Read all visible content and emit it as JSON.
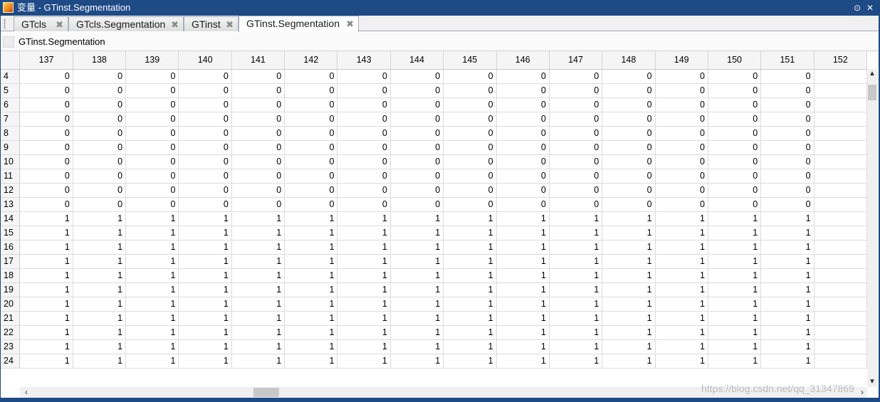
{
  "window": {
    "title": "变量 - GTinst.Segmentation",
    "menu_icon": "dropdown-circle-icon",
    "close_icon": "close-icon",
    "colors": {
      "titlebar": "#1e4a86",
      "background": "#ffffff",
      "header": "#f5f5f5"
    }
  },
  "tabs": [
    {
      "label": "GTcls",
      "active": false
    },
    {
      "label": "GTcls.Segmentation",
      "active": false
    },
    {
      "label": "GTinst",
      "active": false
    },
    {
      "label": "GTinst.Segmentation",
      "active": true
    }
  ],
  "variable": {
    "name": "GTinst.Segmentation"
  },
  "grid": {
    "columns": [
      "137",
      "138",
      "139",
      "140",
      "141",
      "142",
      "143",
      "144",
      "145",
      "146",
      "147",
      "148",
      "149",
      "150",
      "151",
      "152"
    ],
    "rows": [
      {
        "label": "4",
        "cells": [
          "0",
          "0",
          "0",
          "0",
          "0",
          "0",
          "0",
          "0",
          "0",
          "0",
          "0",
          "0",
          "0",
          "0",
          "0",
          ""
        ]
      },
      {
        "label": "5",
        "cells": [
          "0",
          "0",
          "0",
          "0",
          "0",
          "0",
          "0",
          "0",
          "0",
          "0",
          "0",
          "0",
          "0",
          "0",
          "0",
          ""
        ]
      },
      {
        "label": "6",
        "cells": [
          "0",
          "0",
          "0",
          "0",
          "0",
          "0",
          "0",
          "0",
          "0",
          "0",
          "0",
          "0",
          "0",
          "0",
          "0",
          ""
        ]
      },
      {
        "label": "7",
        "cells": [
          "0",
          "0",
          "0",
          "0",
          "0",
          "0",
          "0",
          "0",
          "0",
          "0",
          "0",
          "0",
          "0",
          "0",
          "0",
          ""
        ]
      },
      {
        "label": "8",
        "cells": [
          "0",
          "0",
          "0",
          "0",
          "0",
          "0",
          "0",
          "0",
          "0",
          "0",
          "0",
          "0",
          "0",
          "0",
          "0",
          ""
        ]
      },
      {
        "label": "9",
        "cells": [
          "0",
          "0",
          "0",
          "0",
          "0",
          "0",
          "0",
          "0",
          "0",
          "0",
          "0",
          "0",
          "0",
          "0",
          "0",
          ""
        ]
      },
      {
        "label": "10",
        "cells": [
          "0",
          "0",
          "0",
          "0",
          "0",
          "0",
          "0",
          "0",
          "0",
          "0",
          "0",
          "0",
          "0",
          "0",
          "0",
          ""
        ]
      },
      {
        "label": "11",
        "cells": [
          "0",
          "0",
          "0",
          "0",
          "0",
          "0",
          "0",
          "0",
          "0",
          "0",
          "0",
          "0",
          "0",
          "0",
          "0",
          ""
        ]
      },
      {
        "label": "12",
        "cells": [
          "0",
          "0",
          "0",
          "0",
          "0",
          "0",
          "0",
          "0",
          "0",
          "0",
          "0",
          "0",
          "0",
          "0",
          "0",
          ""
        ]
      },
      {
        "label": "13",
        "cells": [
          "0",
          "0",
          "0",
          "0",
          "0",
          "0",
          "0",
          "0",
          "0",
          "0",
          "0",
          "0",
          "0",
          "0",
          "0",
          ""
        ]
      },
      {
        "label": "14",
        "cells": [
          "1",
          "1",
          "1",
          "1",
          "1",
          "1",
          "1",
          "1",
          "1",
          "1",
          "1",
          "1",
          "1",
          "1",
          "1",
          ""
        ]
      },
      {
        "label": "15",
        "cells": [
          "1",
          "1",
          "1",
          "1",
          "1",
          "1",
          "1",
          "1",
          "1",
          "1",
          "1",
          "1",
          "1",
          "1",
          "1",
          ""
        ]
      },
      {
        "label": "16",
        "cells": [
          "1",
          "1",
          "1",
          "1",
          "1",
          "1",
          "1",
          "1",
          "1",
          "1",
          "1",
          "1",
          "1",
          "1",
          "1",
          ""
        ]
      },
      {
        "label": "17",
        "cells": [
          "1",
          "1",
          "1",
          "1",
          "1",
          "1",
          "1",
          "1",
          "1",
          "1",
          "1",
          "1",
          "1",
          "1",
          "1",
          ""
        ]
      },
      {
        "label": "18",
        "cells": [
          "1",
          "1",
          "1",
          "1",
          "1",
          "1",
          "1",
          "1",
          "1",
          "1",
          "1",
          "1",
          "1",
          "1",
          "1",
          ""
        ]
      },
      {
        "label": "19",
        "cells": [
          "1",
          "1",
          "1",
          "1",
          "1",
          "1",
          "1",
          "1",
          "1",
          "1",
          "1",
          "1",
          "1",
          "1",
          "1",
          ""
        ]
      },
      {
        "label": "20",
        "cells": [
          "1",
          "1",
          "1",
          "1",
          "1",
          "1",
          "1",
          "1",
          "1",
          "1",
          "1",
          "1",
          "1",
          "1",
          "1",
          ""
        ]
      },
      {
        "label": "21",
        "cells": [
          "1",
          "1",
          "1",
          "1",
          "1",
          "1",
          "1",
          "1",
          "1",
          "1",
          "1",
          "1",
          "1",
          "1",
          "1",
          ""
        ]
      },
      {
        "label": "22",
        "cells": [
          "1",
          "1",
          "1",
          "1",
          "1",
          "1",
          "1",
          "1",
          "1",
          "1",
          "1",
          "1",
          "1",
          "1",
          "1",
          ""
        ]
      },
      {
        "label": "23",
        "cells": [
          "1",
          "1",
          "1",
          "1",
          "1",
          "1",
          "1",
          "1",
          "1",
          "1",
          "1",
          "1",
          "1",
          "1",
          "1",
          ""
        ]
      },
      {
        "label": "24",
        "cells": [
          "1",
          "1",
          "1",
          "1",
          "1",
          "1",
          "1",
          "1",
          "1",
          "1",
          "1",
          "1",
          "1",
          "1",
          "1",
          ""
        ]
      }
    ]
  },
  "watermark": "https://blog.csdn.net/qq_31347869"
}
